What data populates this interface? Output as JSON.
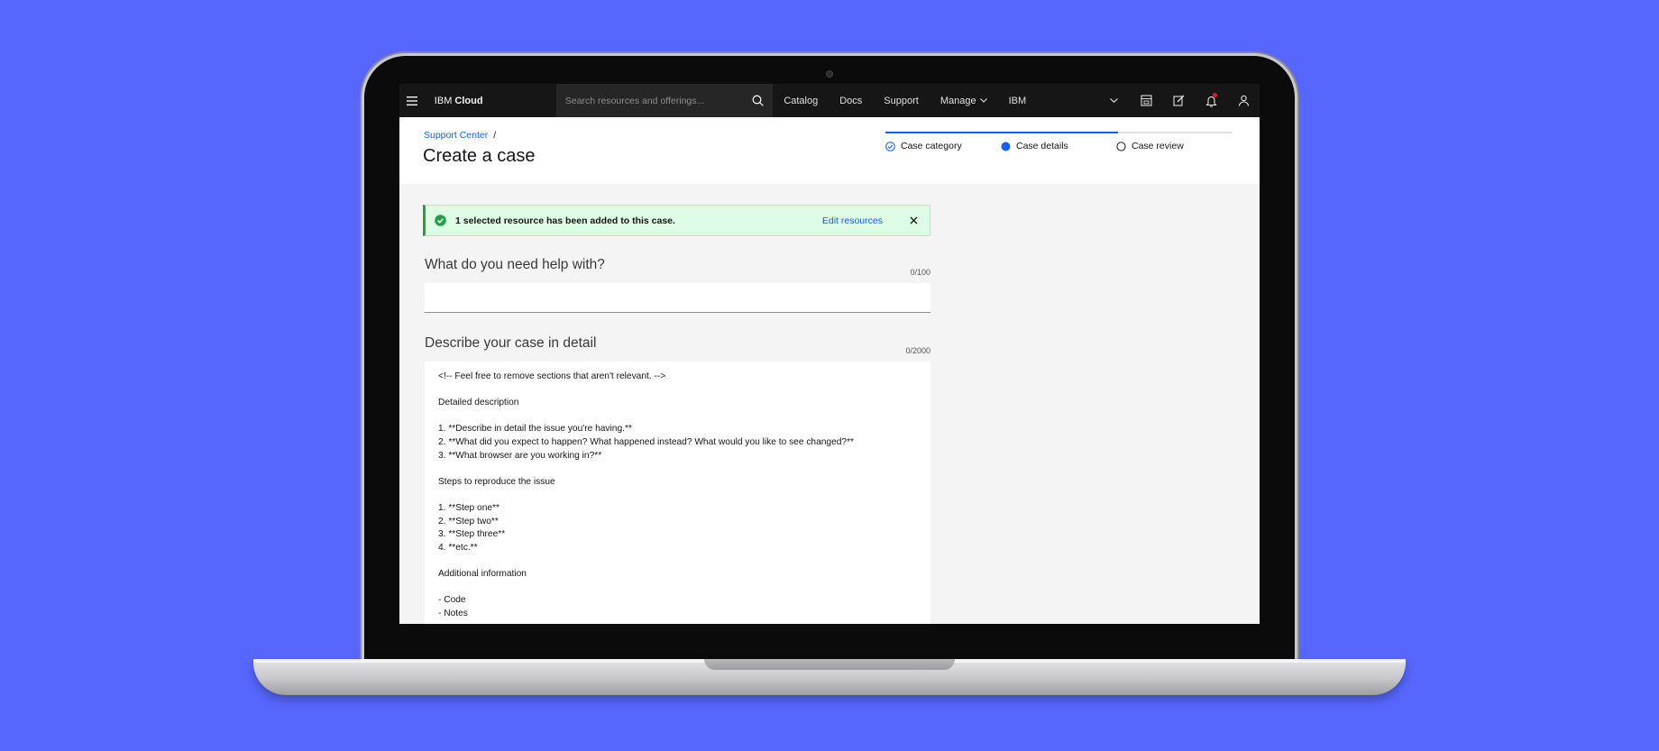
{
  "nav": {
    "brand_prefix": "IBM",
    "brand_name": "Cloud",
    "search_placeholder": "Search resources and offerings...",
    "links": [
      "Catalog",
      "Docs",
      "Support"
    ],
    "manage_label": "Manage",
    "account_label": "IBM"
  },
  "header": {
    "breadcrumb_link": "Support Center",
    "breadcrumb_sep": "/",
    "title": "Create a case",
    "progress_fraction": 0.67,
    "steps": [
      {
        "label": "Case category",
        "state": "complete"
      },
      {
        "label": "Case details",
        "state": "current"
      },
      {
        "label": "Case review",
        "state": "incomplete"
      }
    ]
  },
  "notification": {
    "message": "1 selected resource has been added to this case.",
    "action": "Edit resources"
  },
  "form": {
    "subject_label": "What do you need help with?",
    "subject_counter": "0/100",
    "subject_value": "",
    "detail_label": "Describe your case in detail",
    "detail_counter": "0/2000",
    "detail_lines": [
      "<!-- Feel free to remove sections that aren't relevant. -->",
      "",
      "Detailed description",
      "",
      "1. **Describe in detail the issue you're having.**",
      "2. **What did you expect to happen? What happened instead? What would you like to see changed?**",
      "3. **What browser are you working in?**",
      "",
      "Steps to reproduce the issue",
      "",
      "1. **Step one**",
      "2. **Step two**",
      "3. **Step three**",
      "4. **etc.**",
      "",
      "Additional information",
      "",
      "- Code",
      "- Notes"
    ]
  },
  "colors": {
    "background": "#5767fe",
    "nav_bg": "#161616",
    "accent": "#0f62fe",
    "success": "#24a148",
    "notification_bg": "#defbe6"
  }
}
